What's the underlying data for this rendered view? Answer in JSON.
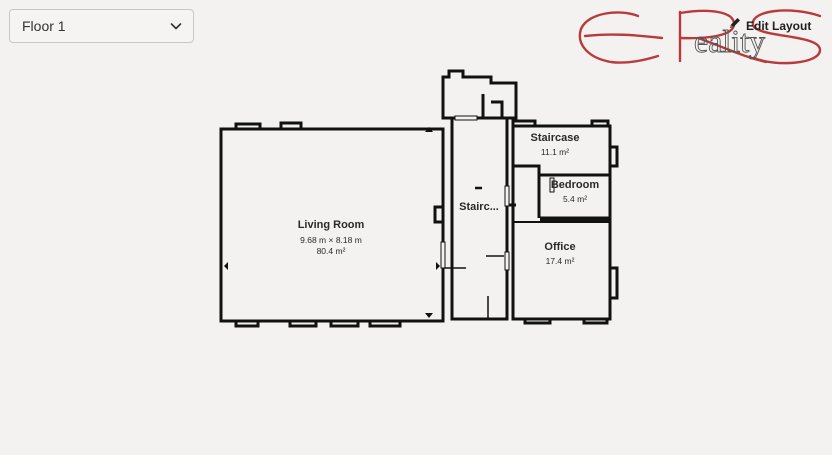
{
  "floor_selector": {
    "selected": "Floor 1"
  },
  "toolbar": {
    "edit_layout_label": "Edit Layout"
  },
  "brand": {
    "logo_text": "ERS Reality",
    "logo_color": "#b93a3a"
  },
  "rooms": {
    "living_room": {
      "name": "Living Room",
      "dimensions": "9.68 m × 8.18 m",
      "area": "80.4 m²"
    },
    "hall": {
      "name": "Stairc..."
    },
    "staircase": {
      "name": "Staircase",
      "area": "11.1 m²"
    },
    "bedroom": {
      "name": "Bedroom",
      "area": "5.4 m²"
    },
    "office": {
      "name": "Office",
      "area": "17.4 m²"
    }
  }
}
